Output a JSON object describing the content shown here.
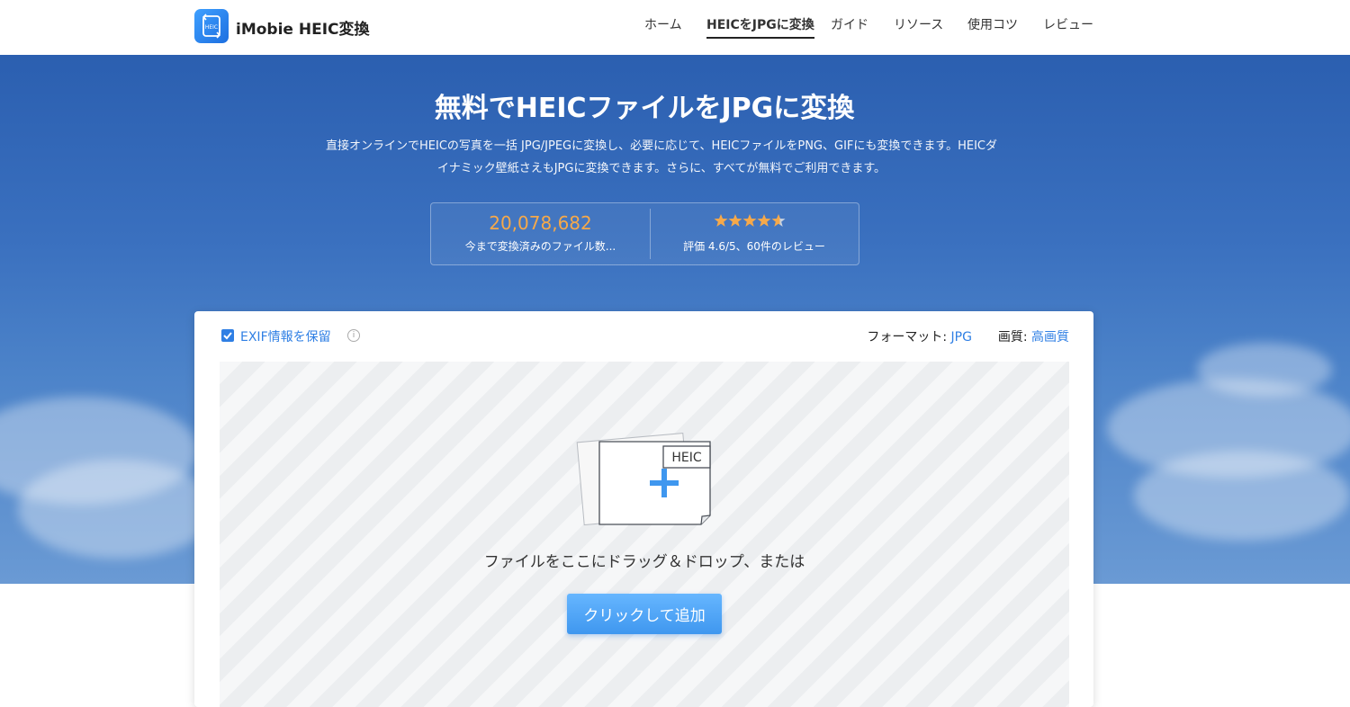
{
  "header": {
    "brand": "iMobie HEIC変換",
    "logo_icon": "heic-convert-logo-icon",
    "nav": [
      {
        "label": "ホーム",
        "active": false
      },
      {
        "label": "HEICをJPGに変換",
        "active": true
      },
      {
        "label": "ガイド",
        "active": false
      },
      {
        "label": "リソース",
        "active": false
      },
      {
        "label": "使用コツ",
        "active": false
      },
      {
        "label": "レビュー",
        "active": false
      }
    ]
  },
  "hero": {
    "title": "無料でHEICファイルをJPGに変換",
    "description_line1": "直接オンラインでHEICの写真を一括 JPG/JPEGに変換し、必要に応じて、HEICファイルをPNG、GIFにも変換できます。HEICダ",
    "description_line2": "イナミック壁紙さえもJPGに変換できます。さらに、すべてが無料でご利用できます。",
    "stats": {
      "count": "20,078,682",
      "count_label": "今まで変換済みのファイル数...",
      "rating_stars": 4.6,
      "rating_label": "評価 4.6/5、60件のレビュー"
    }
  },
  "uploader": {
    "exif_label": "EXIF情報を保留",
    "exif_checked": true,
    "info_icon": "i",
    "format_label": "フォーマット:",
    "format_value": "JPG",
    "quality_label": "画質:",
    "quality_value": "高画質",
    "file_badge": "HEIC",
    "drop_text": "ファイルをここにドラッグ＆ドロップ、または",
    "add_button": "クリックして追加"
  },
  "colors": {
    "accent": "#2f7fe4",
    "stat_count": "#f6a94a",
    "star": "#f6a94a",
    "hero_bg": "#3a70bf"
  }
}
